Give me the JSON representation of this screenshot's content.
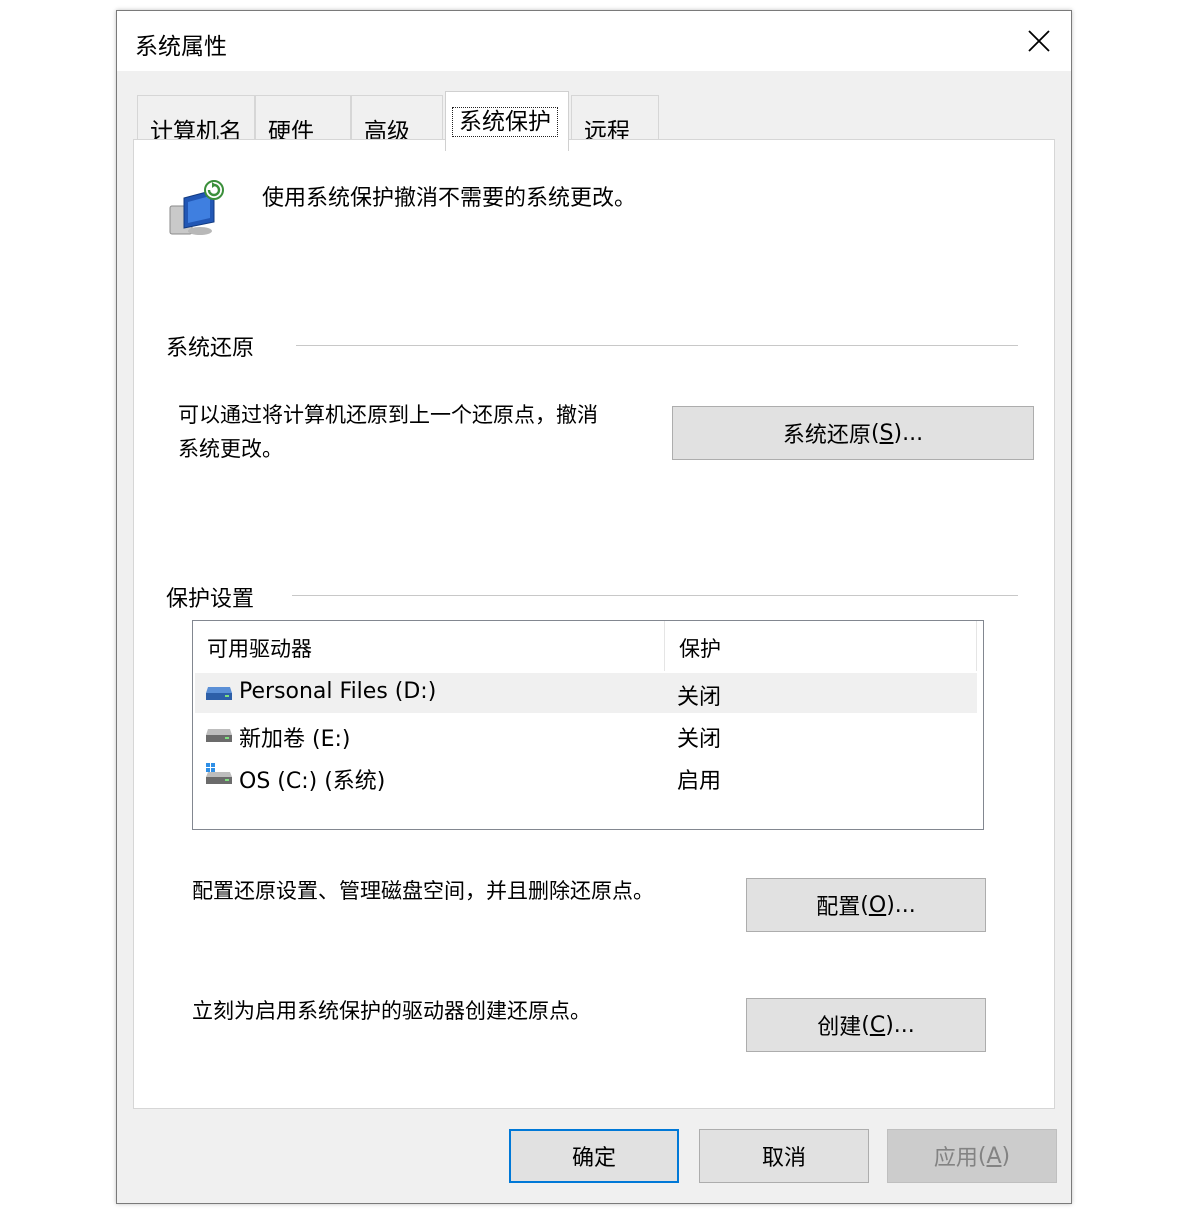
{
  "window": {
    "title": "系统属性"
  },
  "tabs": [
    {
      "label": "计算机名"
    },
    {
      "label": "硬件"
    },
    {
      "label": "高级"
    },
    {
      "label": "系统保护",
      "active": true
    },
    {
      "label": "远程"
    }
  ],
  "intro": {
    "text": "使用系统保护撤消不需要的系统更改。",
    "icon": "system-protection-icon"
  },
  "system_restore": {
    "group_title": "系统还原",
    "description_line1": "可以通过将计算机还原到上一个还原点，撤消",
    "description_line2": "系统更改。",
    "button_label": "系统还原",
    "button_mnemonic_prefix": "(",
    "button_mnemonic": "S",
    "button_suffix": ")..."
  },
  "protection_settings": {
    "group_title": "保护设置",
    "columns": [
      "可用驱动器",
      "保护"
    ],
    "drives": [
      {
        "name": "Personal Files (D:)",
        "status": "关闭",
        "icon": "drive-icon"
      },
      {
        "name": "新加卷 (E:)",
        "status": "关闭",
        "icon": "drive-icon"
      },
      {
        "name": "OS (C:) (系统)",
        "status": "启用",
        "icon": "system-drive-icon"
      }
    ],
    "configure_text": "配置还原设置、管理磁盘空间，并且删除还原点。",
    "configure_label": "配置",
    "configure_mnemonic_prefix": "(",
    "configure_mnemonic": "O",
    "configure_suffix": ")...",
    "create_text": "立刻为启用系统保护的驱动器创建还原点。",
    "create_label": "创建",
    "create_mnemonic_prefix": "(",
    "create_mnemonic": "C",
    "create_suffix": ")..."
  },
  "footer": {
    "ok_label": "确定",
    "cancel_label": "取消",
    "apply_label": "应用",
    "apply_mnemonic_prefix": "(",
    "apply_mnemonic": "A",
    "apply_suffix": ")"
  },
  "colors": {
    "window_bg": "#f0f0f0",
    "panel_bg": "#ffffff",
    "button_bg": "#e1e1e1",
    "focus_border": "#0078d7"
  }
}
